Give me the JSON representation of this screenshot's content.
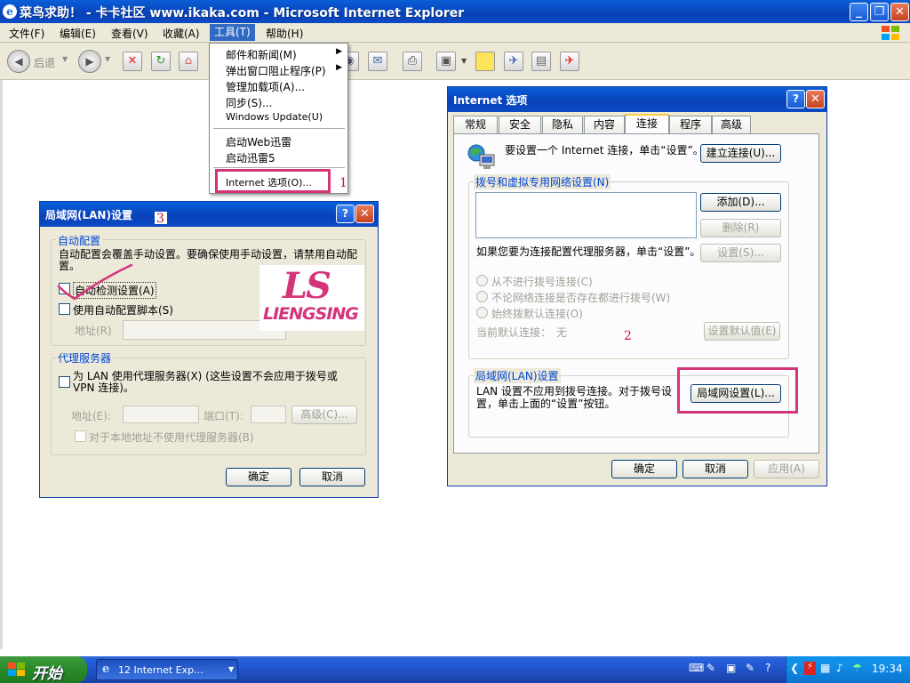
{
  "window": {
    "title": "菜鸟求助！ - 卡卡社区 www.ikaka.com - Microsoft Internet Explorer"
  },
  "menubar": {
    "items": [
      {
        "label": "文件(F)"
      },
      {
        "label": "编辑(E)"
      },
      {
        "label": "查看(V)"
      },
      {
        "label": "收藏(A)"
      },
      {
        "label": "工具(T)"
      },
      {
        "label": "帮助(H)"
      }
    ]
  },
  "toolbar": {
    "back_label": "后退"
  },
  "tools_menu": {
    "items": [
      {
        "label": "邮件和新闻(M)",
        "submenu": true
      },
      {
        "label": "弹出窗口阻止程序(P)",
        "submenu": true
      },
      {
        "label": "管理加载项(A)..."
      },
      {
        "label": "同步(S)..."
      },
      {
        "label": "Windows Update(U)"
      },
      {
        "label": "启动Web迅雷"
      },
      {
        "label": "启动迅雷5"
      },
      {
        "label": "Internet 选项(O)..."
      }
    ]
  },
  "annotations": {
    "step1": "1",
    "step2": "2",
    "step3": "3"
  },
  "internet_options": {
    "title": "Internet 选项",
    "tabs": [
      "常规",
      "安全",
      "隐私",
      "内容",
      "连接",
      "程序",
      "高级"
    ],
    "selected_tab": "连接",
    "setup_text": "要设置一个 Internet 连接，单击“设置”。",
    "setup_button": "建立连接(U)...",
    "dialup_group": "拨号和虚拟专用网络设置(N)",
    "add_button": "添加(D)...",
    "remove_button": "删除(R)",
    "settings_text": "如果您要为连接配置代理服务器，单击“设置”。",
    "settings_button": "设置(S)...",
    "radio_never": "从不进行拨号连接(C)",
    "radio_when_no_net": "不论网络连接是否存在都进行拨号(W)",
    "radio_always": "始终拨默认连接(O)",
    "current_default_label": "当前默认连接：",
    "current_default_value": "无",
    "set_default_button": "设置默认值(E)",
    "lan_group": "局域网(LAN)设置",
    "lan_text": "LAN 设置不应用到拨号连接。对于拨号设置，单击上面的“设置”按钮。",
    "lan_button": "局域网设置(L)...",
    "ok": "确定",
    "cancel": "取消",
    "apply": "应用(A)"
  },
  "lan_dialog": {
    "title": "局域网(LAN)设置",
    "auto_group": "自动配置",
    "auto_desc": "自动配置会覆盖手动设置。要确保使用手动设置，请禁用自动配置。",
    "auto_detect": "自动检测设置(A)",
    "auto_script": "使用自动配置脚本(S)",
    "address_label": "地址(R)",
    "proxy_group": "代理服务器",
    "proxy_checkbox": "为 LAN 使用代理服务器(X) (这些设置不会应用于拨号或 VPN 连接)。",
    "proxy_address_label": "地址(E):",
    "port_label": "端口(T):",
    "advanced_button": "高级(C)...",
    "bypass_local": "对于本地地址不使用代理服务器(B)",
    "ok": "确定",
    "cancel": "取消"
  },
  "watermark": {
    "logo_text": "LS",
    "brand": "LIENGSING"
  },
  "taskbar": {
    "start": "开始",
    "task_item": "12 Internet Exp...",
    "clock": "19:34"
  }
}
